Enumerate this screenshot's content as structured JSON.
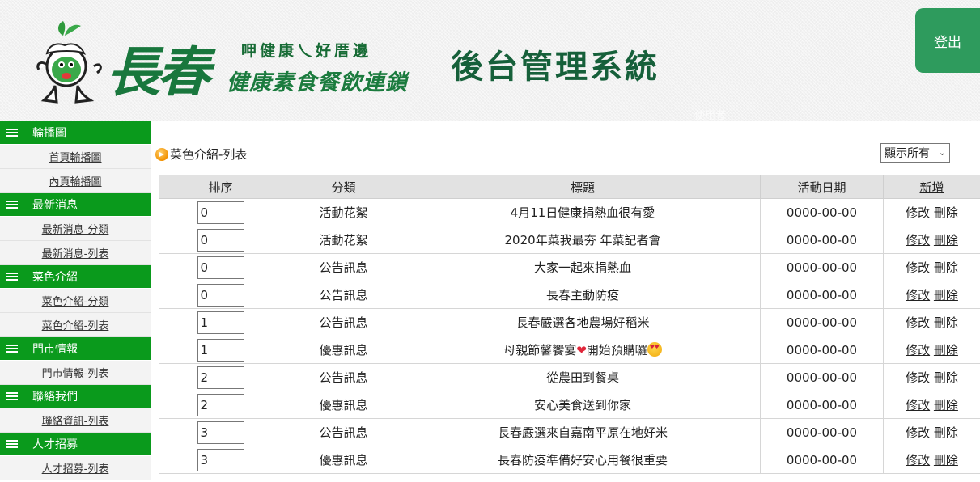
{
  "header": {
    "logo_big": "長春",
    "logo_slogan": "呷健康乀好厝邊",
    "logo_sub": "健康素食餐飲連鎖",
    "system_title": "後台管理系統",
    "logout_label": "登出",
    "user_label": "使用者"
  },
  "sidebar": {
    "groups": [
      {
        "title": "輪播圖",
        "items": [
          "首頁輪播圖",
          "內頁輪播圖"
        ]
      },
      {
        "title": "最新消息",
        "items": [
          "最新消息-分類",
          "最新消息-列表"
        ]
      },
      {
        "title": "菜色介紹",
        "items": [
          "菜色介紹-分類",
          "菜色介紹-列表"
        ]
      },
      {
        "title": "門市情報",
        "items": [
          "門市情報-列表"
        ]
      },
      {
        "title": "聯絡我們",
        "items": [
          "聯絡資訊-列表"
        ]
      },
      {
        "title": "人才招募",
        "items": [
          "人才招募-列表"
        ]
      }
    ]
  },
  "main": {
    "page_title": "菜色介紹-列表",
    "filter": {
      "selected": "顯示所有"
    },
    "columns": {
      "sort": "排序",
      "category": "分類",
      "title": "標題",
      "date": "活動日期",
      "add": "新增"
    },
    "actions": {
      "edit": "修改",
      "delete": "刪除"
    },
    "rows": [
      {
        "sort": "0",
        "category": "活動花絮",
        "title": "4月11日健康捐熱血很有愛",
        "date": "0000-00-00"
      },
      {
        "sort": "0",
        "category": "活動花絮",
        "title": "2020年菜我最夯 年菜記者會",
        "date": "0000-00-00"
      },
      {
        "sort": "0",
        "category": "公告訊息",
        "title": "大家一起來捐熱血",
        "date": "0000-00-00"
      },
      {
        "sort": "0",
        "category": "公告訊息",
        "title": "長春主動防疫",
        "date": "0000-00-00"
      },
      {
        "sort": "1",
        "category": "公告訊息",
        "title": "長春嚴選各地農場好稻米",
        "date": "0000-00-00"
      },
      {
        "sort": "1",
        "category": "優惠訊息",
        "title": "母親節馨饗宴",
        "title_after": "開始預購囉",
        "emoji": true,
        "date": "0000-00-00"
      },
      {
        "sort": "2",
        "category": "公告訊息",
        "title": "從農田到餐桌",
        "date": "0000-00-00"
      },
      {
        "sort": "2",
        "category": "優惠訊息",
        "title": "安心美食送到你家",
        "date": "0000-00-00"
      },
      {
        "sort": "3",
        "category": "公告訊息",
        "title": "長春嚴選來自嘉南平原在地好米",
        "date": "0000-00-00"
      },
      {
        "sort": "3",
        "category": "優惠訊息",
        "title": "長春防疫準備好安心用餐很重要",
        "date": "0000-00-00"
      }
    ]
  },
  "colors": {
    "menu_green": "#0a9a1c",
    "logout_green": "#2e9b5d",
    "title_green": "#16603a"
  },
  "icons": {
    "menu": "hamburger-icon",
    "title_bullet": "orange-arrow-icon",
    "select": "chevron-down-icon"
  }
}
